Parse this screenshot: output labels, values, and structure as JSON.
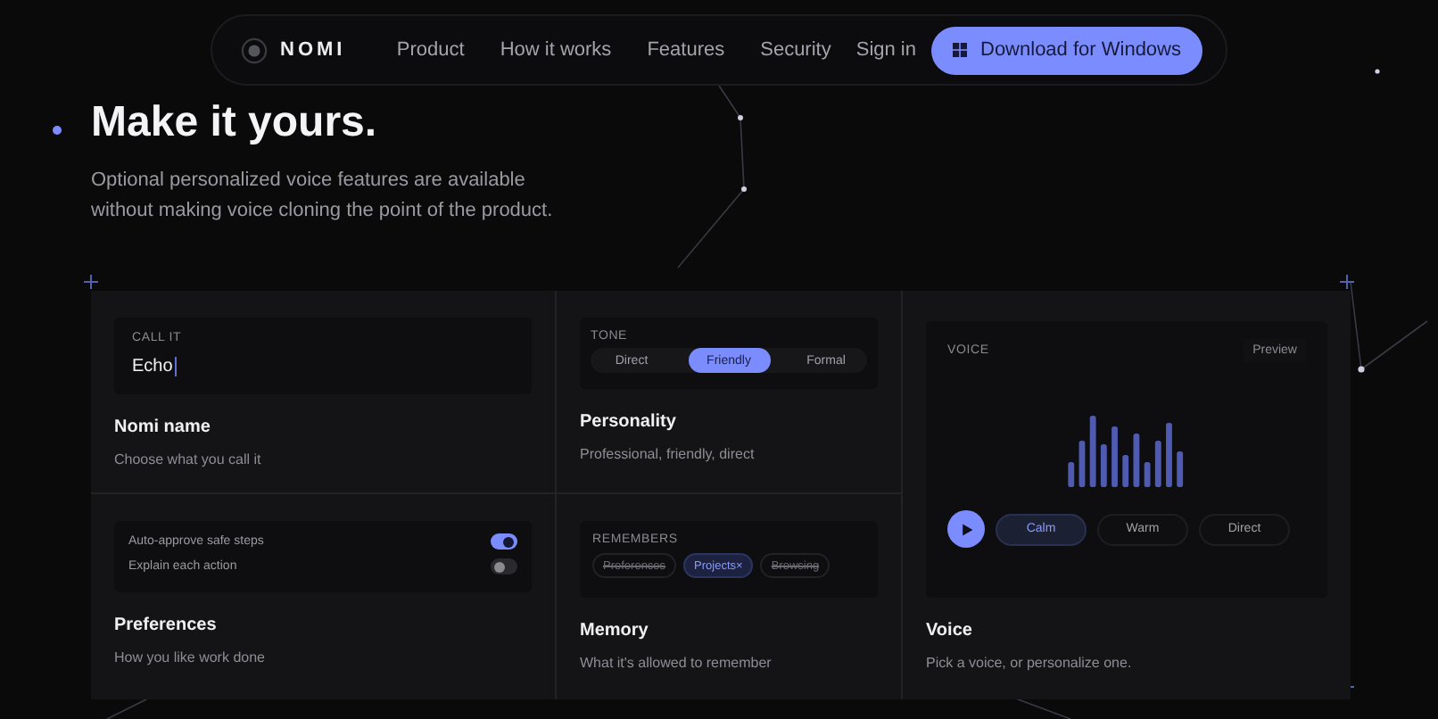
{
  "nav": {
    "brand": "NOMI",
    "links": [
      "Product",
      "How it works",
      "Features",
      "Security"
    ],
    "sign_in": "Sign in",
    "download": "Download for Windows"
  },
  "hero": {
    "title": "Make it yours.",
    "subtitle": "Optional personalized voice features are available without making voice cloning the point of the product."
  },
  "name_card": {
    "field_label": "CALL IT",
    "value": "Echo",
    "title": "Nomi name",
    "description": "Choose what you call it"
  },
  "personality_card": {
    "label": "TONE",
    "options": [
      {
        "label": "Direct",
        "selected": false
      },
      {
        "label": "Friendly",
        "selected": true
      },
      {
        "label": "Formal",
        "selected": false
      }
    ],
    "title": "Personality",
    "description": "Professional, friendly, direct"
  },
  "preferences_card": {
    "toggles": [
      {
        "label": "Auto-approve safe steps",
        "on": true
      },
      {
        "label": "Explain each action",
        "on": false
      }
    ],
    "title": "Preferences",
    "description": "How you like work done"
  },
  "memory_card": {
    "label": "REMEMBERS",
    "chips": [
      {
        "label": "Preferences",
        "selected": false
      },
      {
        "label": "Projects",
        "selected": true,
        "remove": "×"
      },
      {
        "label": "Browsing",
        "selected": false
      }
    ],
    "title": "Memory",
    "description": "What it's allowed to remember"
  },
  "voice_card": {
    "label": "VOICE",
    "preview": "Preview",
    "options": [
      {
        "label": "Calm",
        "selected": true
      },
      {
        "label": "Warm",
        "selected": false
      },
      {
        "label": "Direct",
        "selected": false
      }
    ],
    "title": "Voice",
    "description": "Pick a voice, or personalize one."
  }
}
